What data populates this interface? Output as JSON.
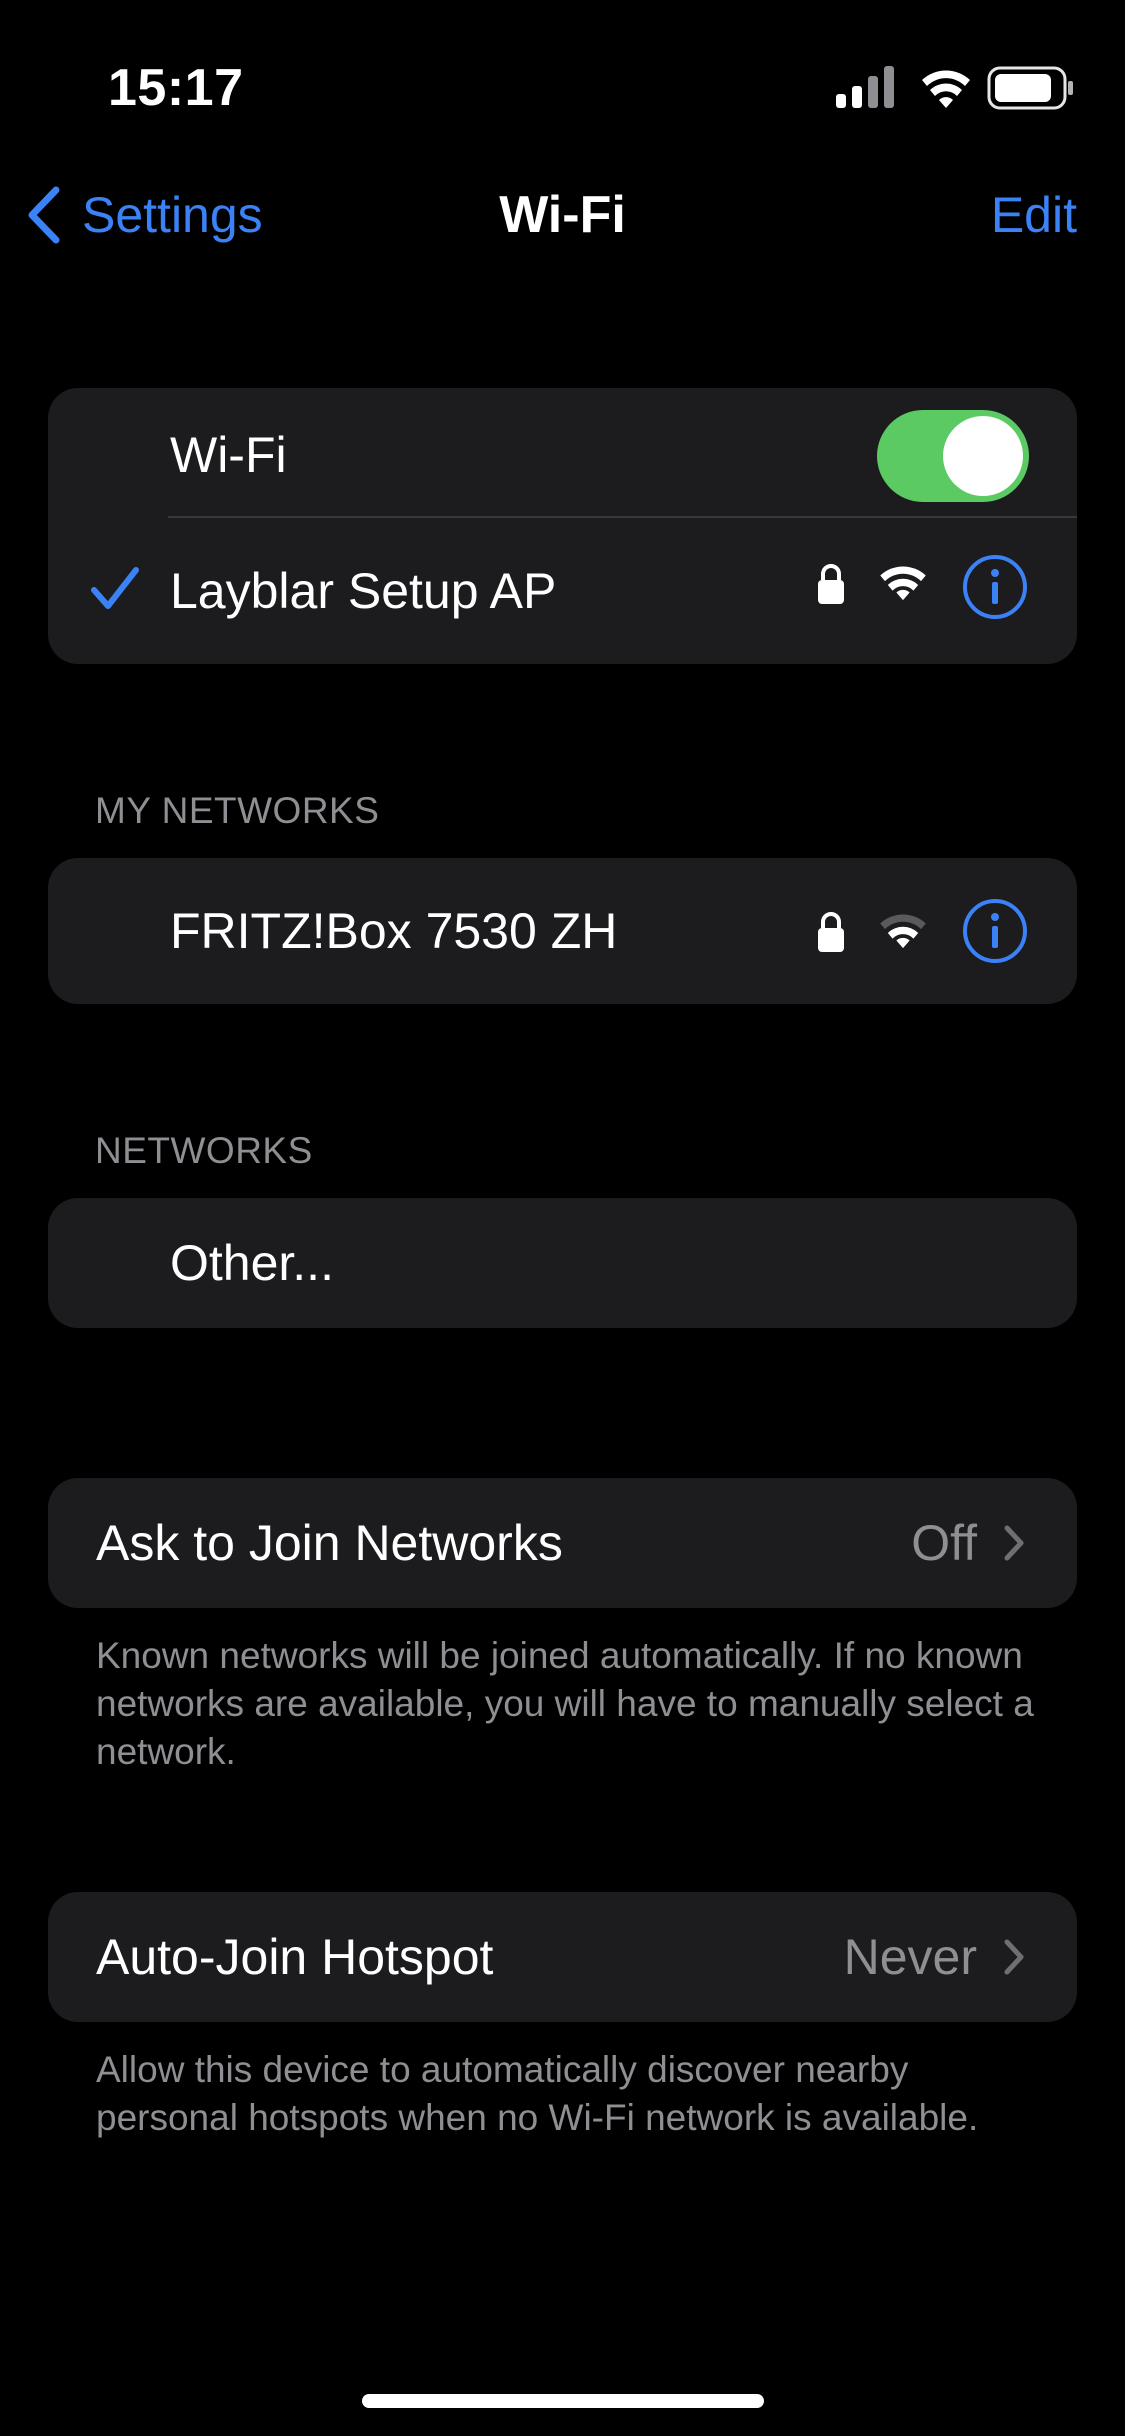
{
  "status_bar": {
    "time": "15:17",
    "icons": [
      "cellular-signal-icon",
      "wifi-icon",
      "battery-icon"
    ]
  },
  "nav": {
    "back_label": "Settings",
    "title": "Wi-Fi",
    "edit_label": "Edit"
  },
  "wifi_group": {
    "toggle_label": "Wi-Fi",
    "toggle_on": true,
    "connected_network": "Layblar Setup AP"
  },
  "my_networks": {
    "header": "MY NETWORKS",
    "items": [
      {
        "name": "FRITZ!Box 7530 ZH"
      }
    ]
  },
  "networks": {
    "header": "NETWORKS",
    "other_label": "Other..."
  },
  "ask_to_join": {
    "label": "Ask to Join Networks",
    "value": "Off",
    "footnote": "Known networks will be joined automatically. If no known networks are available, you will have to manually select a network."
  },
  "auto_join_hotspot": {
    "label": "Auto-Join Hotspot",
    "value": "Never",
    "footnote": "Allow this device to automatically discover nearby personal hotspots when no Wi-Fi network is available."
  },
  "colors": {
    "accent": "#3b82f6",
    "toggle_on": "#5cca63",
    "cell_background": "#1c1c1e",
    "secondary_text": "#8e8e93"
  }
}
